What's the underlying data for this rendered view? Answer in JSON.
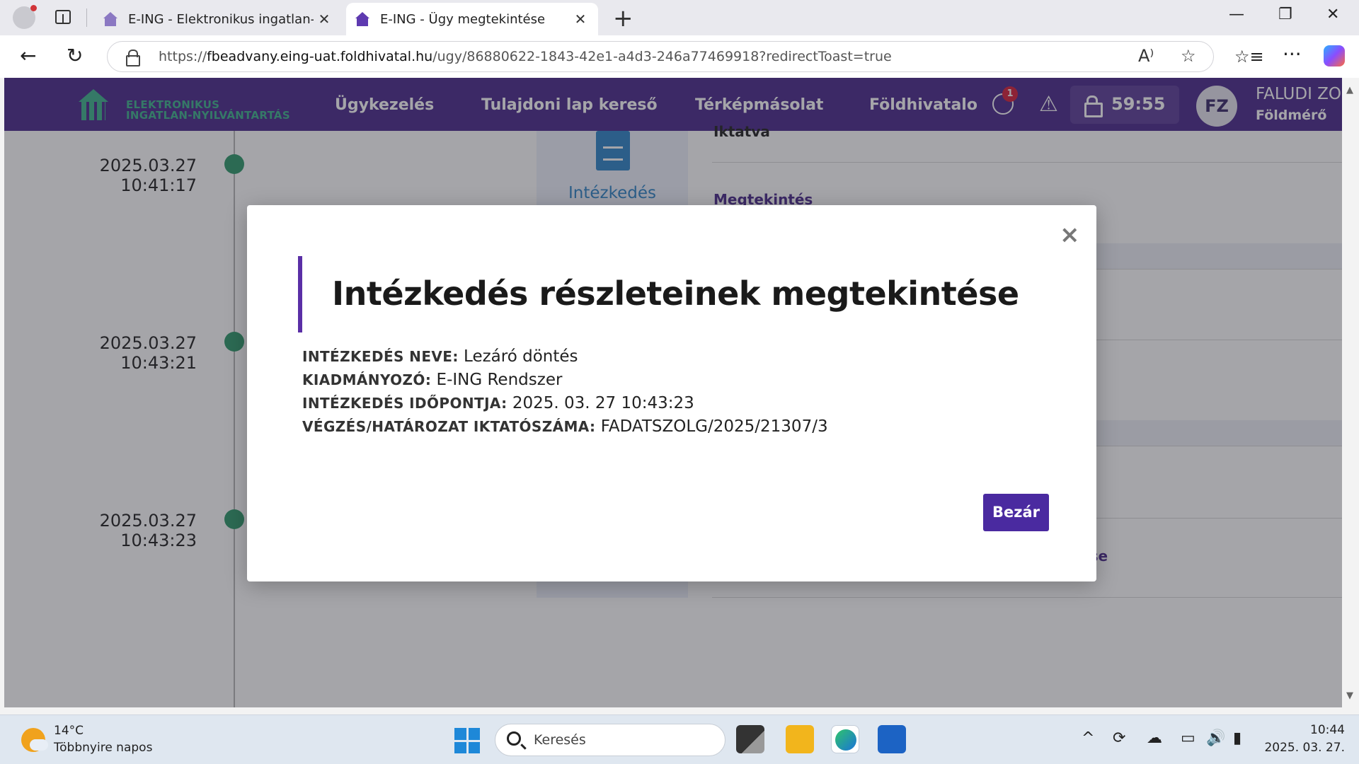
{
  "browser": {
    "tabs": [
      {
        "title": "E-ING - Elektronikus ingatlan-nyil",
        "active": false
      },
      {
        "title": "E-ING - Ügy megtekintése",
        "active": true
      }
    ],
    "url_scheme": "https://",
    "url_host": "fbeadvany.eing-uat.foldhivatal.hu",
    "url_path": "/ugy/86880622-1843-42e1-a4d3-246a77469918?redirectToast=true",
    "icons": [
      "profile-icon",
      "tab-actions-icon",
      "back-icon",
      "refresh-icon",
      "lock-icon",
      "read-aloud-icon",
      "favorite-icon",
      "favorites-icon",
      "more-icon",
      "copilot-icon"
    ]
  },
  "app": {
    "logo_line1": "ELEKTRONIKUS",
    "logo_line2": "INGATLAN-NYILVÁNTARTÁS",
    "menu": [
      "Ügykezelés",
      "Tulajdoni lap kereső",
      "Térképmásolat",
      "Földhivatalo"
    ],
    "notification_count": "1",
    "timer": "59:55",
    "user_initials": "FZ",
    "user_name": "FALUDI ZO",
    "user_role": "Földmérő",
    "brand_color": "#4a2a8c",
    "accent_green": "#3fb38d"
  },
  "timeline": {
    "entries": [
      {
        "time": "2025.03.27 10:41:17"
      },
      {
        "time": "2025.03.27 10:43:21"
      },
      {
        "time": "2025.03.27 10:43:23"
      }
    ]
  },
  "background_card": {
    "icon_label": "Intézkedés",
    "heading_fragment": "Iktatva",
    "link": "Megtekintés",
    "link_fragment": "ése"
  },
  "modal": {
    "title": "Intézkedés részleteinek megtekintése",
    "fields": [
      {
        "key": "INTÉZKEDÉS NEVE:",
        "value": "Lezáró döntés"
      },
      {
        "key": "KIADMÁNYOZÓ:",
        "value": "E-ING Rendszer"
      },
      {
        "key": "INTÉZKEDÉS IDŐPONTJA:",
        "value": "2025. 03. 27 10:43:23"
      },
      {
        "key": "VÉGZÉS/HATÁROZAT IKTATÓSZÁMA:",
        "value": "FADATSZOLG/2025/21307/3"
      }
    ],
    "close_button": "Bezár",
    "close_icon": "×"
  },
  "taskbar": {
    "weather_temp": "14°C",
    "weather_desc": "Többnyire napos",
    "search_placeholder": "Keresés",
    "clock_time": "10:44",
    "clock_date": "2025. 03. 27."
  }
}
